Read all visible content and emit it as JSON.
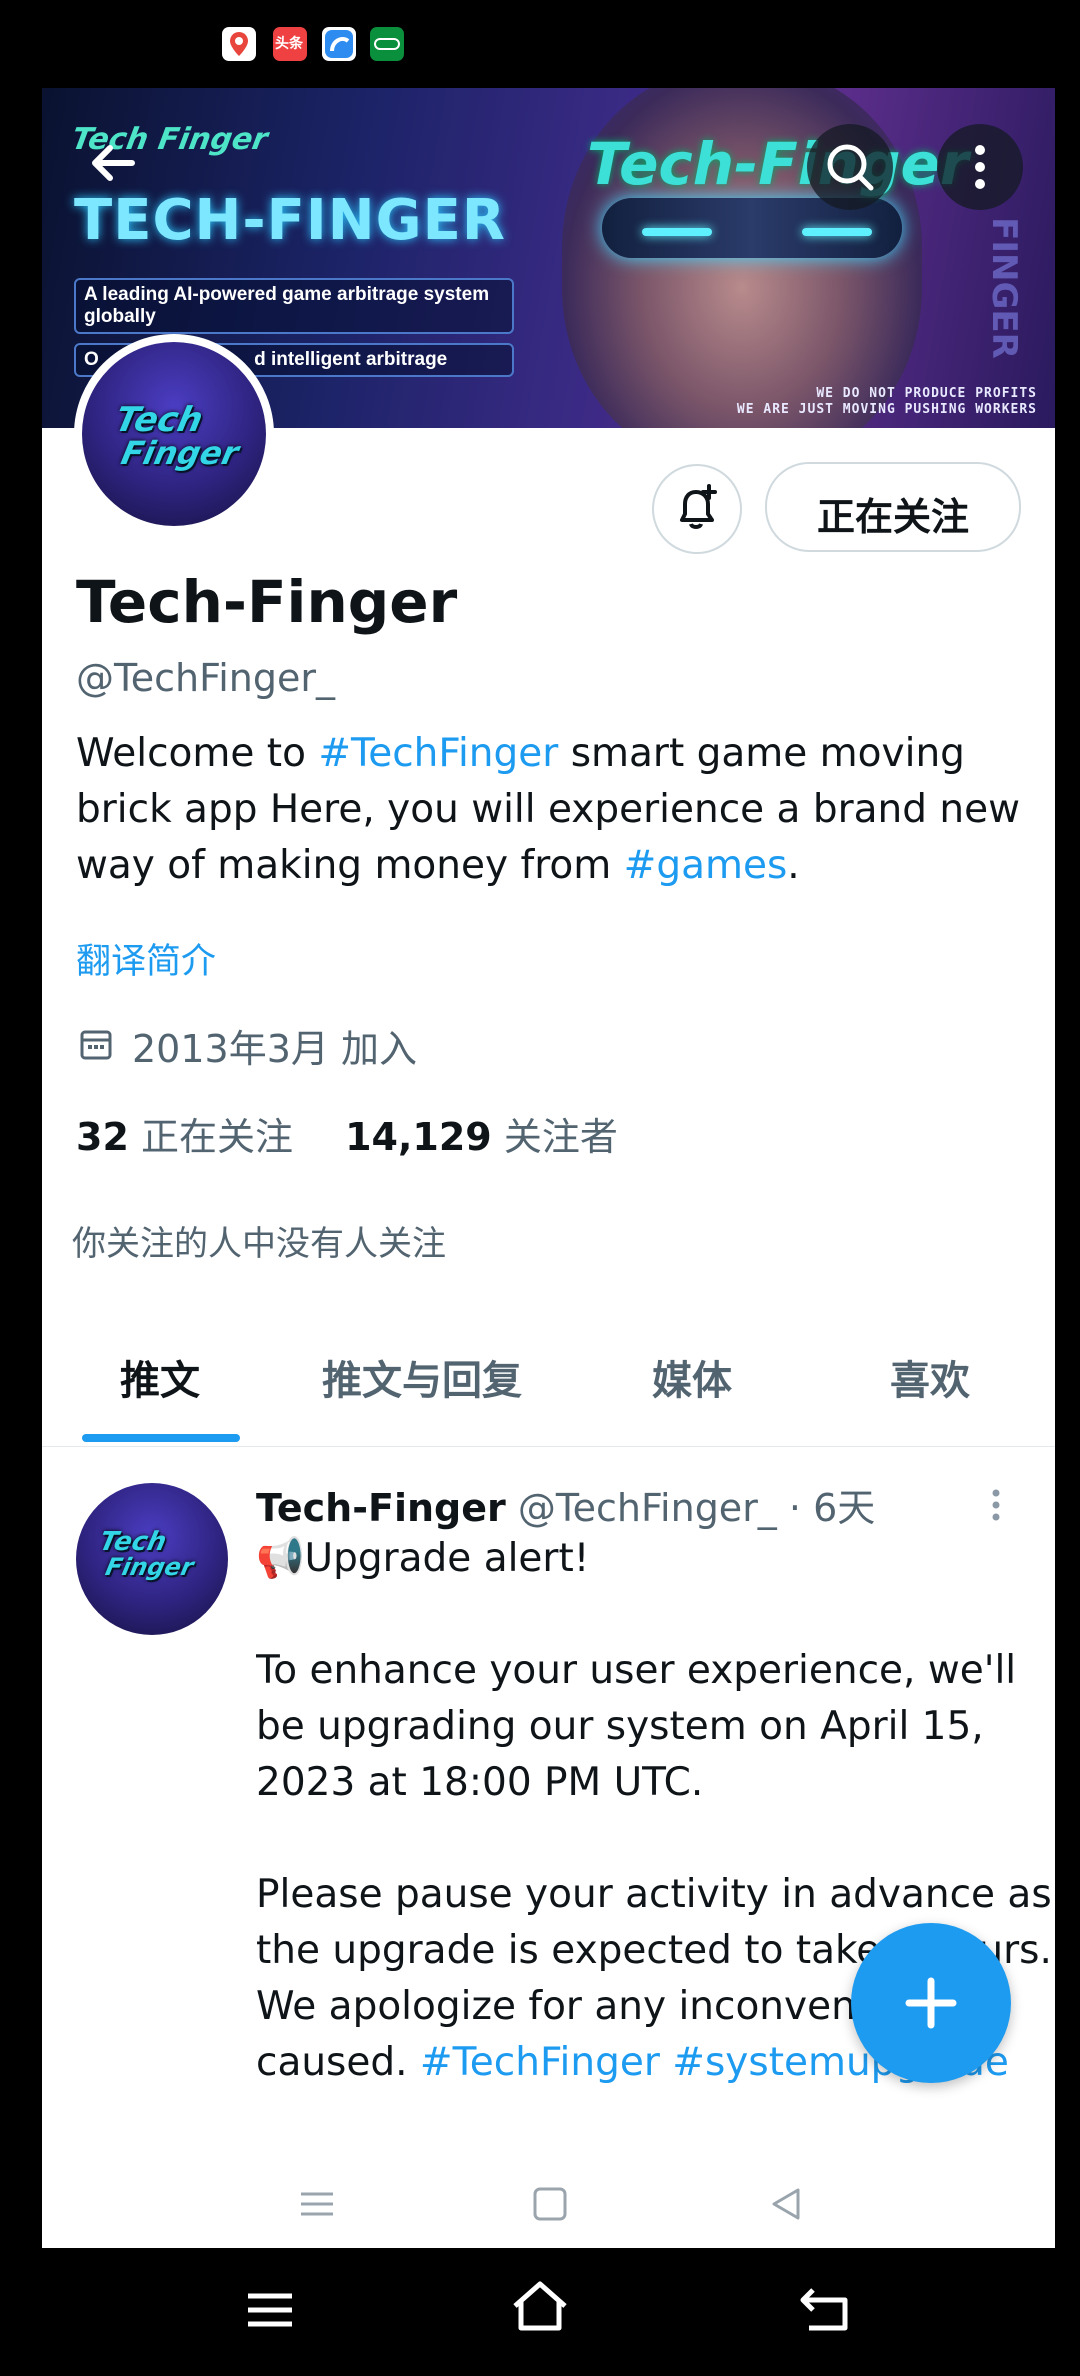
{
  "colors": {
    "accent": "#1d9bf0",
    "text": "#0f1419",
    "muted": "#536471"
  },
  "status_bar": {
    "app_icons": [
      "maps-app-icon",
      "toutiao-app-icon",
      "browser-app-icon",
      "wallet-app-icon"
    ],
    "toutiao_label": "头条"
  },
  "banner": {
    "logo_text": "Tech Finger",
    "title": "TECH-FINGER",
    "brand": "Tech-Finger",
    "box1": "A leading AI-powered game arbitrage system globally",
    "box2_left": "O",
    "box2_right": "d intelligent arbitrage",
    "fine1": "WE DO NOT PRODUCE PROFITS",
    "fine2": "WE ARE JUST MOVING PUSHING WORKERS",
    "side_text": "FINGER"
  },
  "profile": {
    "avatar_text_1": "Tech",
    "avatar_text_2": "Finger",
    "follow_button": "正在关注",
    "display_name": "Tech-Finger",
    "handle": "@TechFinger_",
    "bio": {
      "p1": "Welcome to ",
      "tag1": "#TechFinger",
      "p2": " smart game moving brick app Here, you will experience a brand new way of making money from ",
      "tag2": "#games",
      "p3": "."
    },
    "translate_link": "翻译简介",
    "joined": "2013年3月 加入",
    "following_count": "32",
    "following_label": "正在关注",
    "followers_count": "14,129",
    "followers_label": "关注者",
    "followed_by": "你关注的人中没有人关注"
  },
  "tabs": [
    {
      "label": "推文",
      "active": true
    },
    {
      "label": "推文与回复",
      "active": false
    },
    {
      "label": "媒体",
      "active": false
    },
    {
      "label": "喜欢",
      "active": false
    }
  ],
  "tweet": {
    "author": "Tech-Finger",
    "handle": "@TechFinger_",
    "time": "· 6天",
    "line1": "📢Upgrade alert!",
    "para2": "To enhance your user experience, we'll be upgrading our system on April 15, 2023 at 18:00 PM UTC.",
    "para3": "Please pause your activity in advance as the upgrade is expected to take 2 hours. We apologize for any inconvenience caused. ",
    "tag1": "#TechFinger",
    "tag2": "#systemupgrade"
  },
  "fab": {
    "icon": "plus-icon"
  }
}
